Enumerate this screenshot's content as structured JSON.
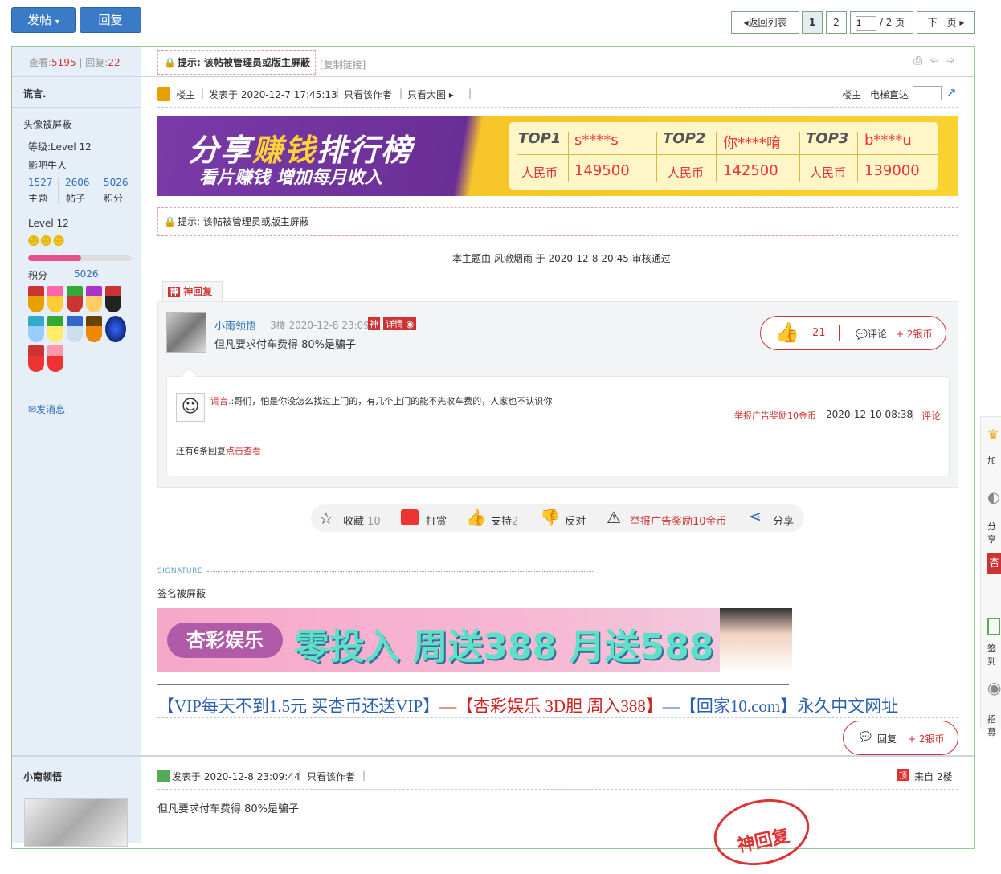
{
  "toolbar": {
    "post_label": "发帖",
    "reply_label": "回复",
    "back_label": "返回列表",
    "page1": "1",
    "page2": "2",
    "page_input": "1",
    "page_total": "/ 2 页",
    "next_label": "下一页"
  },
  "stats": {
    "views_label": "查看:",
    "views": "5195",
    "replies_label": "回复:",
    "replies": "22"
  },
  "thread": {
    "tip": "提示: 该帖被管理员或版主屏蔽",
    "copy_link": "[复制链接]"
  },
  "author": {
    "name": "谎言.",
    "avatar_text": "头像被屏蔽",
    "level_label": "等级:",
    "level": "Level 12",
    "title": "影吧牛人",
    "topics": "1527",
    "posts": "2606",
    "points": "5026",
    "topics_label": "主题",
    "posts_label": "帖子",
    "points_label": "积分",
    "level_text": "Level 12",
    "points_row_label": "积分",
    "points_row_value": "5026",
    "message_label": "发消息"
  },
  "post1": {
    "floor": "楼主",
    "posted": "发表于 2020-12-7 17:45:13",
    "only_author": "只看该作者",
    "only_big": "只看大图",
    "floor_right": "楼主",
    "elevator": "电梯直达"
  },
  "banner1": {
    "title1": "分享",
    "title2": "赚钱",
    "title3": "排行榜",
    "subtitle": "看片赚钱 增加每月收入",
    "top1": "TOP1",
    "top1_user": "s****s",
    "top2": "TOP2",
    "top2_user": "你****唷",
    "top3": "TOP3",
    "top3_user": "b****u",
    "currency": "人民币",
    "v1": "149500",
    "v2": "142500",
    "v3": "139000"
  },
  "tip2": "提示: 该帖被管理员或版主屏蔽",
  "approval": "本主题由 风澈烟雨 于 2020-12-8 20:45 审核通过",
  "shen": {
    "tab": "神回复",
    "user": "小南领悟",
    "meta": "3楼 2020-12-8 23:09",
    "badge": "神",
    "detail": "详情",
    "content": "但凡要求付车费得 80%是骗子",
    "likes": "21",
    "comment": "评论",
    "reward": "+ 2银币"
  },
  "comment": {
    "user": "谎言.",
    "text": ":哥们，怕是你没怎么找过上门的，有几个上门的能不先收车费的，人家也不认识你",
    "report": "举报广告奖励10金币",
    "time": "2020-12-10 08:38",
    "reply": "评论",
    "more_prefix": "还有6条回复",
    "more_link": "点击查看"
  },
  "actions": {
    "fav": "收藏",
    "fav_count": "10",
    "tip": "打赏",
    "support": "支持",
    "support_count": "2",
    "oppose": "反对",
    "report": "举报广告奖励10金币",
    "share": "分享"
  },
  "signature": {
    "label": "SIGNATURE",
    "text": "签名被屏蔽",
    "banner_logo": "杏彩娱乐",
    "banner_text": "零投入 周送388 月送588",
    "link1": "【VIP每天不到1.5元 买杏币还送VIP】",
    "dash1": "—",
    "link2": "【杏彩娱乐 3D胆 周入388】",
    "dash2": "—",
    "link3": "【回家10.com】永久中文网址"
  },
  "reply_pill": {
    "label": "回复",
    "reward": "+ 2银币"
  },
  "post2": {
    "author": "小南领悟",
    "posted": "发表于 2020-12-8 23:09:44",
    "only_author": "只看该作者",
    "from": "来自 2楼",
    "content": "但凡要求付车费得 80%是骗子",
    "stamp": "神回复",
    "top_badge": "顶"
  },
  "sidebar_right": [
    "加",
    "分享",
    "杏",
    "签到",
    "招募"
  ]
}
